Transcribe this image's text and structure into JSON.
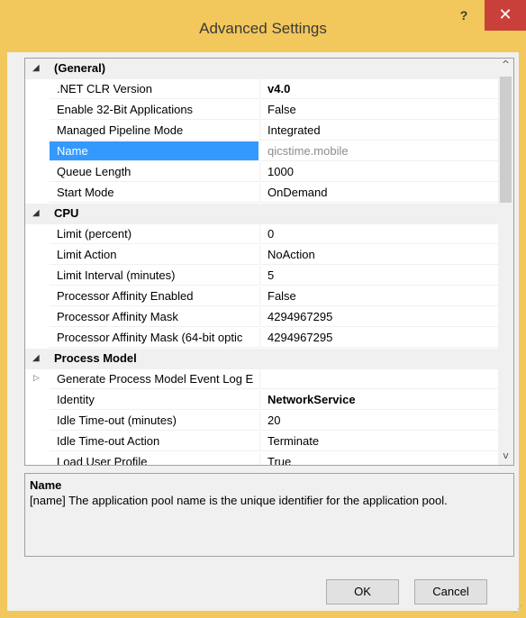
{
  "window": {
    "title": "Advanced Settings",
    "help_label": "?",
    "close_label": "✕"
  },
  "grid": {
    "categories": [
      {
        "label": "(General)",
        "rows": [
          {
            "name": ".NET CLR Version",
            "value": "v4.0",
            "style": "bold"
          },
          {
            "name": "Enable 32-Bit Applications",
            "value": "False"
          },
          {
            "name": "Managed Pipeline Mode",
            "value": "Integrated"
          },
          {
            "name": "Name",
            "value": "qicstime.mobile",
            "style": "grey",
            "selected": true
          },
          {
            "name": "Queue Length",
            "value": "1000"
          },
          {
            "name": "Start Mode",
            "value": "OnDemand"
          }
        ]
      },
      {
        "label": "CPU",
        "rows": [
          {
            "name": "Limit (percent)",
            "value": "0"
          },
          {
            "name": "Limit Action",
            "value": "NoAction"
          },
          {
            "name": "Limit Interval (minutes)",
            "value": "5"
          },
          {
            "name": "Processor Affinity Enabled",
            "value": "False"
          },
          {
            "name": "Processor Affinity Mask",
            "value": "4294967295"
          },
          {
            "name": "Processor Affinity Mask (64-bit optic",
            "value": "4294967295"
          }
        ]
      },
      {
        "label": "Process Model",
        "rows": [
          {
            "name": "Generate Process Model Event Log E",
            "value": "",
            "expandable": true
          },
          {
            "name": "Identity",
            "value": "NetworkService",
            "style": "bold"
          },
          {
            "name": "Idle Time-out (minutes)",
            "value": "20"
          },
          {
            "name": "Idle Time-out Action",
            "value": "Terminate"
          },
          {
            "name": "Load User Profile",
            "value": "True"
          }
        ]
      }
    ]
  },
  "description": {
    "title": "Name",
    "text": "[name] The application pool name is the unique identifier for the application pool."
  },
  "buttons": {
    "ok": "OK",
    "cancel": "Cancel"
  },
  "icons": {
    "collapse": "triangle-down-icon",
    "expand": "triangle-right-icon",
    "scroll_up": "chevron-up-icon",
    "scroll_down": "chevron-down-icon"
  },
  "colors": {
    "title_bar": "#f2c75b",
    "close_button": "#c9403a",
    "selection": "#3399ff"
  }
}
